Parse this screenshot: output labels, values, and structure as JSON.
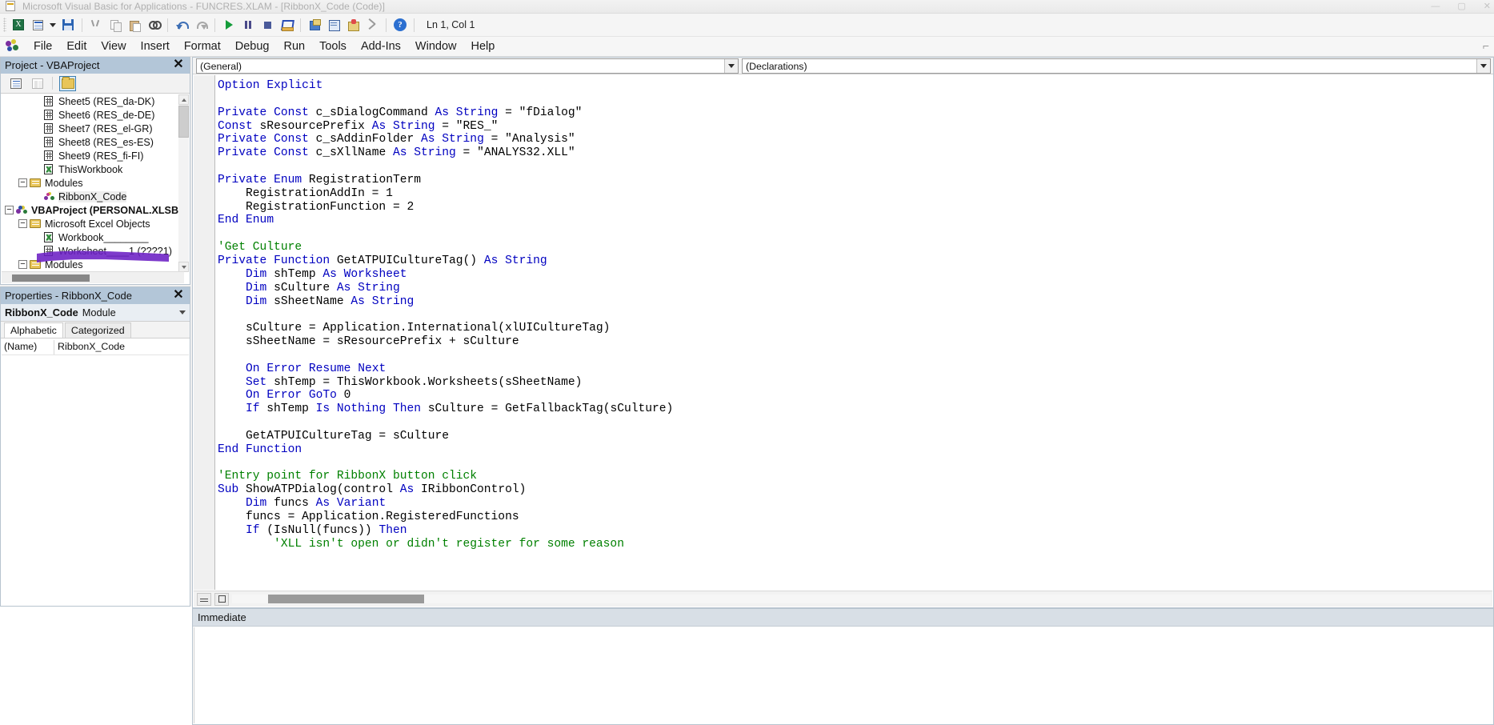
{
  "window": {
    "title": "Microsoft Visual Basic for Applications - FUNCRES.XLAM - [RibbonX_Code (Code)]",
    "minimize_label": "—",
    "maximize_label": "▢",
    "close_label": "✕",
    "app_icon": "vba-app-icon"
  },
  "toolbar": {
    "buttons": [
      {
        "name": "view-excel-button",
        "icon": "excel-icon",
        "tooltip": "View Microsoft Excel"
      },
      {
        "name": "insert-userform-button",
        "icon": "insert-object-icon",
        "tooltip": "Insert"
      },
      {
        "name": "insert-dropdown-button",
        "icon": "chevron-down-icon",
        "tooltip": "Insert menu"
      },
      {
        "name": "save-button",
        "icon": "save-icon",
        "tooltip": "Save FUNCRES.XLAM"
      },
      {
        "name": "cut-button",
        "icon": "scissors-icon",
        "tooltip": "Cut"
      },
      {
        "name": "copy-button",
        "icon": "copy-icon",
        "tooltip": "Copy"
      },
      {
        "name": "paste-button",
        "icon": "paste-icon",
        "tooltip": "Paste"
      },
      {
        "name": "find-button",
        "icon": "binoculars-icon",
        "tooltip": "Find"
      },
      {
        "name": "undo-button",
        "icon": "undo-arrow-icon",
        "tooltip": "Undo"
      },
      {
        "name": "redo-button",
        "icon": "redo-arrow-icon",
        "tooltip": "Redo"
      },
      {
        "name": "run-button",
        "icon": "play-icon",
        "tooltip": "Run Sub/UserForm"
      },
      {
        "name": "break-button",
        "icon": "pause-icon",
        "tooltip": "Break"
      },
      {
        "name": "reset-button",
        "icon": "stop-icon",
        "tooltip": "Reset"
      },
      {
        "name": "design-mode-button",
        "icon": "design-mode-icon",
        "tooltip": "Design Mode"
      },
      {
        "name": "project-explorer-button",
        "icon": "project-explorer-icon",
        "tooltip": "Project Explorer"
      },
      {
        "name": "properties-window-button",
        "icon": "properties-window-icon",
        "tooltip": "Properties Window"
      },
      {
        "name": "object-browser-button",
        "icon": "object-browser-icon",
        "tooltip": "Object Browser"
      },
      {
        "name": "toolbox-button",
        "icon": "toolbox-icon",
        "tooltip": "Toolbox"
      },
      {
        "name": "help-button",
        "icon": "help-icon",
        "tooltip": "Help",
        "glyph": "?"
      }
    ],
    "position_indicator": "Ln 1, Col 1"
  },
  "menubar": {
    "logo": "vba-logo-icon",
    "items": [
      "File",
      "Edit",
      "View",
      "Insert",
      "Format",
      "Debug",
      "Run",
      "Tools",
      "Add-Ins",
      "Window",
      "Help"
    ],
    "right_glyph": "⌐"
  },
  "project_explorer": {
    "title": "Project - VBAProject",
    "close_label": "✕",
    "toolbar": [
      {
        "name": "view-code-button",
        "icon": "view-code-icon",
        "selected": false
      },
      {
        "name": "view-object-button",
        "icon": "view-object-icon",
        "selected": false
      },
      {
        "name": "toggle-folders-button",
        "icon": "folder-icon",
        "selected": true
      }
    ],
    "tree": [
      {
        "label": "Sheet5 (RES_da-DK)",
        "icon": "worksheet-icon",
        "depth": 3,
        "expander": "",
        "bold": false,
        "selected": false
      },
      {
        "label": "Sheet6 (RES_de-DE)",
        "icon": "worksheet-icon",
        "depth": 3,
        "expander": "",
        "bold": false,
        "selected": false
      },
      {
        "label": "Sheet7 (RES_el-GR)",
        "icon": "worksheet-icon",
        "depth": 3,
        "expander": "",
        "bold": false,
        "selected": false
      },
      {
        "label": "Sheet8 (RES_es-ES)",
        "icon": "worksheet-icon",
        "depth": 3,
        "expander": "",
        "bold": false,
        "selected": false
      },
      {
        "label": "Sheet9 (RES_fi-FI)",
        "icon": "worksheet-icon",
        "depth": 3,
        "expander": "",
        "bold": false,
        "selected": false
      },
      {
        "label": "ThisWorkbook",
        "icon": "thisworkbook-icon",
        "depth": 3,
        "expander": "",
        "bold": false,
        "selected": false
      },
      {
        "label": "Modules",
        "icon": "modules-folder-icon",
        "depth": 2,
        "expander": "−",
        "bold": false,
        "selected": false
      },
      {
        "label": "RibbonX_Code",
        "icon": "module-icon",
        "depth": 3,
        "expander": "",
        "bold": false,
        "selected": true
      },
      {
        "label": "VBAProject (PERSONAL.XLSB)",
        "icon": "vbaproject-icon",
        "depth": 1,
        "expander": "−",
        "bold": true,
        "selected": false
      },
      {
        "label": "Microsoft Excel Objects",
        "icon": "modules-folder-icon",
        "depth": 2,
        "expander": "−",
        "bold": false,
        "selected": false
      },
      {
        "label": "Workbook________",
        "icon": "thisworkbook-icon",
        "depth": 3,
        "expander": "",
        "bold": false,
        "selected": false
      },
      {
        "label": "Worksheet____1 (????1)",
        "icon": "worksheet-icon",
        "depth": 3,
        "expander": "",
        "bold": false,
        "selected": false
      },
      {
        "label": "Modules",
        "icon": "modules-folder-icon",
        "depth": 2,
        "expander": "−",
        "bold": false,
        "selected": false
      }
    ],
    "annotation": {
      "name": "purple-highlighter-stroke",
      "color": "#6b1fc4"
    }
  },
  "properties": {
    "title": "Properties - RibbonX_Code",
    "close_label": "✕",
    "object_name": "RibbonX_Code",
    "object_type": "Module",
    "tabs": [
      {
        "label": "Alphabetic",
        "active": true
      },
      {
        "label": "Categorized",
        "active": false
      }
    ],
    "rows": [
      {
        "key": "(Name)",
        "value": "RibbonX_Code"
      }
    ]
  },
  "code_window": {
    "object_combo": {
      "value": "(General)"
    },
    "procedure_combo": {
      "value": "(Declarations)"
    },
    "code_lines": [
      "Option Explicit",
      "",
      "Private Const c_sDialogCommand As String = \"fDialog\"",
      "Const sResourcePrefix As String = \"RES_\"",
      "Private Const c_sAddinFolder As String = \"Analysis\"",
      "Private Const c_sXllName As String = \"ANALYS32.XLL\"",
      "",
      "Private Enum RegistrationTerm",
      "    RegistrationAddIn = 1",
      "    RegistrationFunction = 2",
      "End Enum",
      "",
      "'Get Culture",
      "Private Function GetATPUICultureTag() As String",
      "    Dim shTemp As Worksheet",
      "    Dim sCulture As String",
      "    Dim sSheetName As String",
      "",
      "    sCulture = Application.International(xlUICultureTag)",
      "    sSheetName = sResourcePrefix + sCulture",
      "",
      "    On Error Resume Next",
      "    Set shTemp = ThisWorkbook.Worksheets(sSheetName)",
      "    On Error GoTo 0",
      "    If shTemp Is Nothing Then sCulture = GetFallbackTag(sCulture)",
      "",
      "    GetATPUICultureTag = sCulture",
      "End Function",
      "",
      "'Entry point for RibbonX button click",
      "Sub ShowATPDialog(control As IRibbonControl)",
      "    Dim funcs As Variant",
      "    funcs = Application.RegisteredFunctions",
      "    If (IsNull(funcs)) Then",
      "        'XLL isn't open or didn't register for some reason"
    ]
  },
  "immediate_window": {
    "title": "Immediate"
  }
}
